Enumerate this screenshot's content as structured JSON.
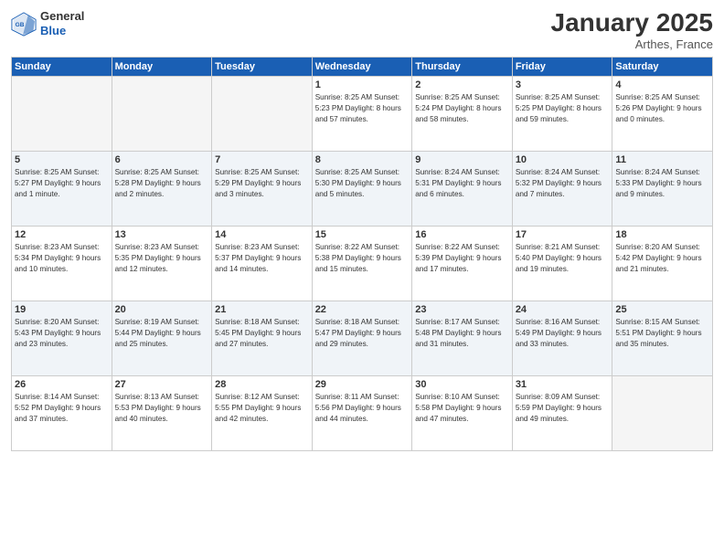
{
  "logo": {
    "general": "General",
    "blue": "Blue"
  },
  "title": "January 2025",
  "location": "Arthes, France",
  "days_header": [
    "Sunday",
    "Monday",
    "Tuesday",
    "Wednesday",
    "Thursday",
    "Friday",
    "Saturday"
  ],
  "weeks": [
    [
      {
        "day": "",
        "info": ""
      },
      {
        "day": "",
        "info": ""
      },
      {
        "day": "",
        "info": ""
      },
      {
        "day": "1",
        "info": "Sunrise: 8:25 AM\nSunset: 5:23 PM\nDaylight: 8 hours and 57 minutes."
      },
      {
        "day": "2",
        "info": "Sunrise: 8:25 AM\nSunset: 5:24 PM\nDaylight: 8 hours and 58 minutes."
      },
      {
        "day": "3",
        "info": "Sunrise: 8:25 AM\nSunset: 5:25 PM\nDaylight: 8 hours and 59 minutes."
      },
      {
        "day": "4",
        "info": "Sunrise: 8:25 AM\nSunset: 5:26 PM\nDaylight: 9 hours and 0 minutes."
      }
    ],
    [
      {
        "day": "5",
        "info": "Sunrise: 8:25 AM\nSunset: 5:27 PM\nDaylight: 9 hours and 1 minute."
      },
      {
        "day": "6",
        "info": "Sunrise: 8:25 AM\nSunset: 5:28 PM\nDaylight: 9 hours and 2 minutes."
      },
      {
        "day": "7",
        "info": "Sunrise: 8:25 AM\nSunset: 5:29 PM\nDaylight: 9 hours and 3 minutes."
      },
      {
        "day": "8",
        "info": "Sunrise: 8:25 AM\nSunset: 5:30 PM\nDaylight: 9 hours and 5 minutes."
      },
      {
        "day": "9",
        "info": "Sunrise: 8:24 AM\nSunset: 5:31 PM\nDaylight: 9 hours and 6 minutes."
      },
      {
        "day": "10",
        "info": "Sunrise: 8:24 AM\nSunset: 5:32 PM\nDaylight: 9 hours and 7 minutes."
      },
      {
        "day": "11",
        "info": "Sunrise: 8:24 AM\nSunset: 5:33 PM\nDaylight: 9 hours and 9 minutes."
      }
    ],
    [
      {
        "day": "12",
        "info": "Sunrise: 8:23 AM\nSunset: 5:34 PM\nDaylight: 9 hours and 10 minutes."
      },
      {
        "day": "13",
        "info": "Sunrise: 8:23 AM\nSunset: 5:35 PM\nDaylight: 9 hours and 12 minutes."
      },
      {
        "day": "14",
        "info": "Sunrise: 8:23 AM\nSunset: 5:37 PM\nDaylight: 9 hours and 14 minutes."
      },
      {
        "day": "15",
        "info": "Sunrise: 8:22 AM\nSunset: 5:38 PM\nDaylight: 9 hours and 15 minutes."
      },
      {
        "day": "16",
        "info": "Sunrise: 8:22 AM\nSunset: 5:39 PM\nDaylight: 9 hours and 17 minutes."
      },
      {
        "day": "17",
        "info": "Sunrise: 8:21 AM\nSunset: 5:40 PM\nDaylight: 9 hours and 19 minutes."
      },
      {
        "day": "18",
        "info": "Sunrise: 8:20 AM\nSunset: 5:42 PM\nDaylight: 9 hours and 21 minutes."
      }
    ],
    [
      {
        "day": "19",
        "info": "Sunrise: 8:20 AM\nSunset: 5:43 PM\nDaylight: 9 hours and 23 minutes."
      },
      {
        "day": "20",
        "info": "Sunrise: 8:19 AM\nSunset: 5:44 PM\nDaylight: 9 hours and 25 minutes."
      },
      {
        "day": "21",
        "info": "Sunrise: 8:18 AM\nSunset: 5:45 PM\nDaylight: 9 hours and 27 minutes."
      },
      {
        "day": "22",
        "info": "Sunrise: 8:18 AM\nSunset: 5:47 PM\nDaylight: 9 hours and 29 minutes."
      },
      {
        "day": "23",
        "info": "Sunrise: 8:17 AM\nSunset: 5:48 PM\nDaylight: 9 hours and 31 minutes."
      },
      {
        "day": "24",
        "info": "Sunrise: 8:16 AM\nSunset: 5:49 PM\nDaylight: 9 hours and 33 minutes."
      },
      {
        "day": "25",
        "info": "Sunrise: 8:15 AM\nSunset: 5:51 PM\nDaylight: 9 hours and 35 minutes."
      }
    ],
    [
      {
        "day": "26",
        "info": "Sunrise: 8:14 AM\nSunset: 5:52 PM\nDaylight: 9 hours and 37 minutes."
      },
      {
        "day": "27",
        "info": "Sunrise: 8:13 AM\nSunset: 5:53 PM\nDaylight: 9 hours and 40 minutes."
      },
      {
        "day": "28",
        "info": "Sunrise: 8:12 AM\nSunset: 5:55 PM\nDaylight: 9 hours and 42 minutes."
      },
      {
        "day": "29",
        "info": "Sunrise: 8:11 AM\nSunset: 5:56 PM\nDaylight: 9 hours and 44 minutes."
      },
      {
        "day": "30",
        "info": "Sunrise: 8:10 AM\nSunset: 5:58 PM\nDaylight: 9 hours and 47 minutes."
      },
      {
        "day": "31",
        "info": "Sunrise: 8:09 AM\nSunset: 5:59 PM\nDaylight: 9 hours and 49 minutes."
      },
      {
        "day": "",
        "info": ""
      }
    ]
  ]
}
